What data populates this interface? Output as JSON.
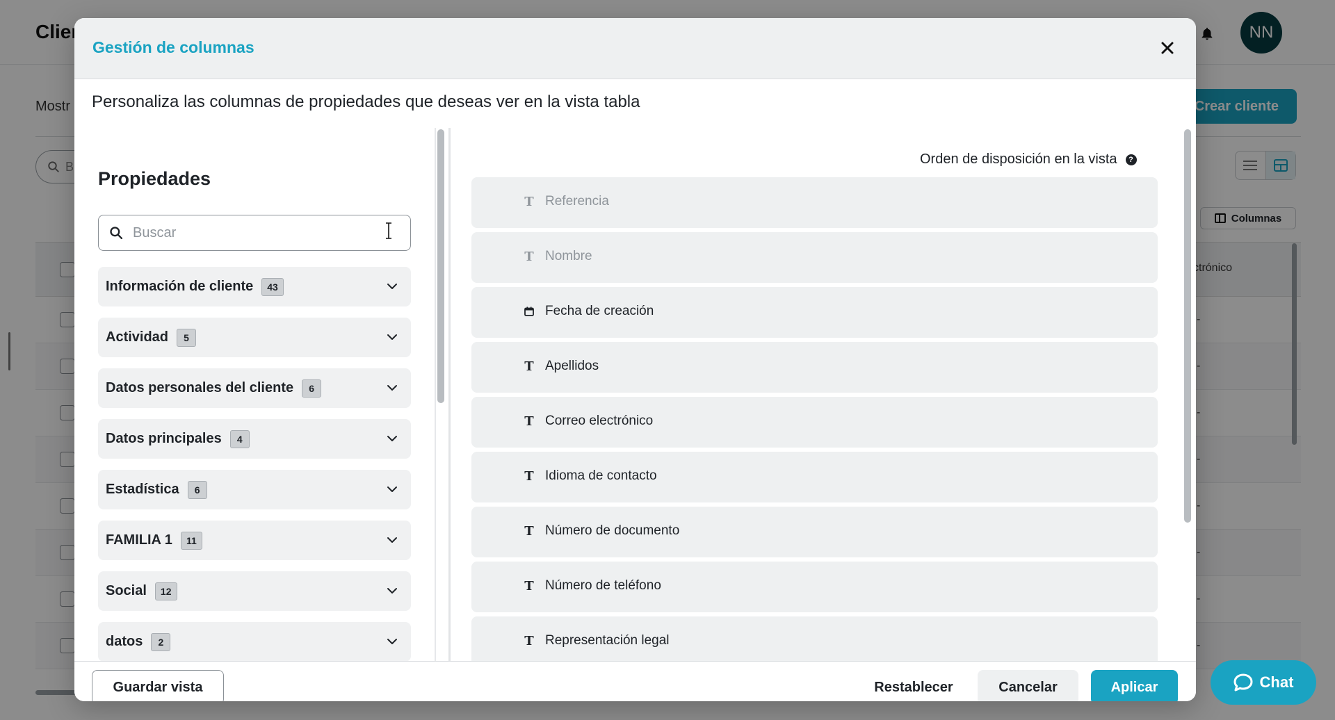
{
  "background": {
    "title": "Clien",
    "avatar_initials": "NN",
    "showing_text": "Mostr",
    "create_button": "Crear cliente",
    "search_placeholder": "Bu",
    "columns_button": "Columnas",
    "table_header_partial": "ctrónico",
    "row_value": "-"
  },
  "modal": {
    "title": "Gestión de columnas",
    "description": "Personaliza las columnas de propiedades que deseas ver en la vista tabla",
    "properties_title": "Propiedades",
    "search_placeholder": "Buscar",
    "order_label": "Orden de disposición en la vista",
    "groups": [
      {
        "label": "Información de cliente",
        "count": "43"
      },
      {
        "label": "Actividad",
        "count": "5"
      },
      {
        "label": "Datos personales del cliente",
        "count": "6"
      },
      {
        "label": "Datos principales",
        "count": "4"
      },
      {
        "label": "Estadística",
        "count": "6"
      },
      {
        "label": "FAMILIA 1",
        "count": "11"
      },
      {
        "label": "Social",
        "count": "12"
      },
      {
        "label": "datos",
        "count": "2"
      }
    ],
    "ordered_columns": [
      {
        "label": "Referencia",
        "type": "text",
        "icon": "T",
        "locked": true
      },
      {
        "label": "Nombre",
        "type": "text",
        "icon": "T",
        "locked": true
      },
      {
        "label": "Fecha de creación",
        "type": "date",
        "icon": "calendar-icon",
        "locked": false
      },
      {
        "label": "Apellidos",
        "type": "text",
        "icon": "T",
        "locked": false
      },
      {
        "label": "Correo electrónico",
        "type": "text",
        "icon": "T",
        "locked": false
      },
      {
        "label": "Idioma de contacto",
        "type": "text",
        "icon": "T",
        "locked": false
      },
      {
        "label": "Número de documento",
        "type": "text",
        "icon": "T",
        "locked": false
      },
      {
        "label": "Número de teléfono",
        "type": "text",
        "icon": "T",
        "locked": false
      },
      {
        "label": "Representación legal",
        "type": "text",
        "icon": "T",
        "locked": false
      }
    ],
    "footer": {
      "save_view": "Guardar vista",
      "reset": "Restablecer",
      "cancel": "Cancelar",
      "apply": "Aplicar"
    }
  },
  "chat": {
    "label": "Chat"
  },
  "colors": {
    "accent": "#1aa3c2",
    "avatar_bg": "#073b40",
    "item_bg": "#eef0f1",
    "overlay": "rgba(0,0,0,0.45)"
  }
}
